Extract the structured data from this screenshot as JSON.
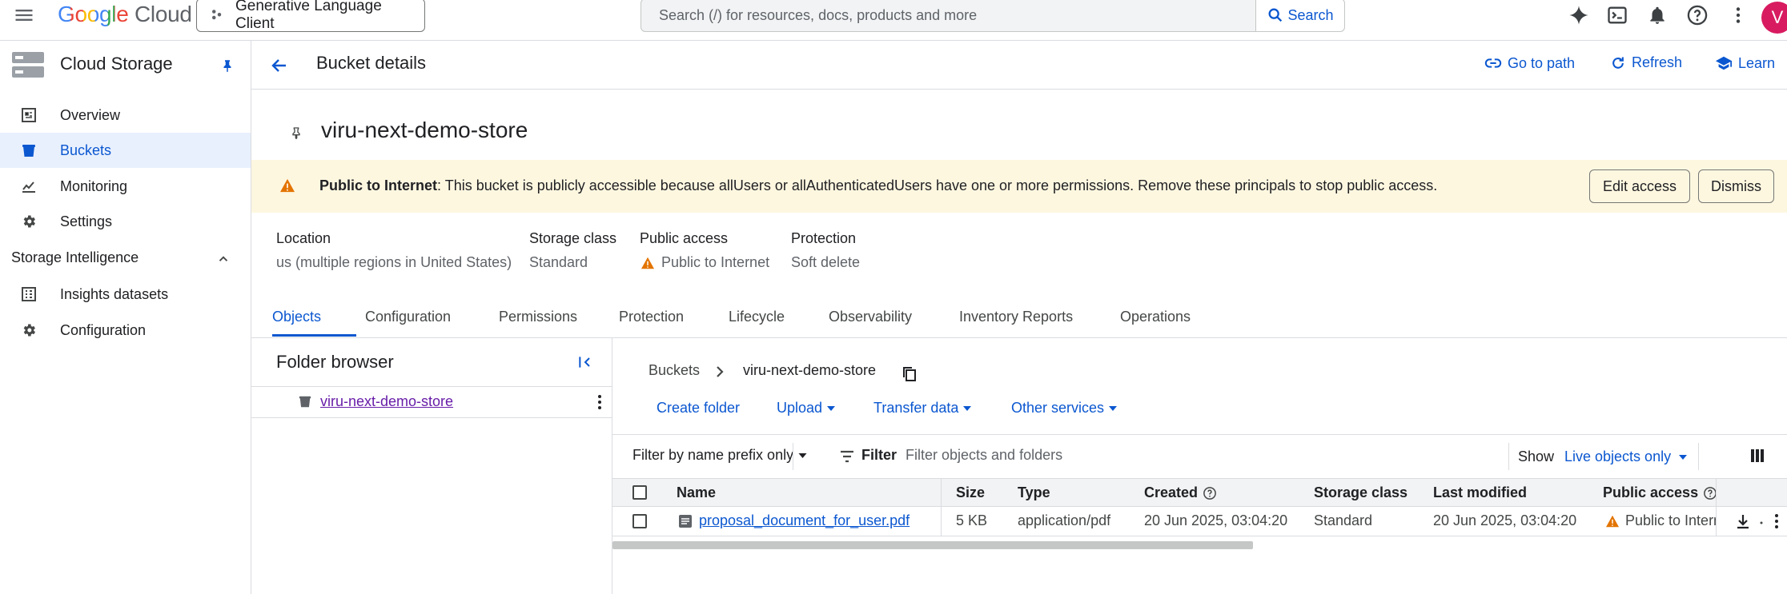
{
  "topbar": {
    "logo_google": "Google",
    "logo_cloud": "Cloud",
    "project": "Generative Language Client",
    "search_placeholder": "Search (/) for resources, docs, products and more",
    "search_button": "Search",
    "avatar_letter": "V"
  },
  "sidebar": {
    "title": "Cloud Storage",
    "items": [
      {
        "label": "Overview",
        "icon": "dashboard-icon"
      },
      {
        "label": "Buckets",
        "icon": "bucket-icon"
      },
      {
        "label": "Monitoring",
        "icon": "monitoring-icon"
      },
      {
        "label": "Settings",
        "icon": "gear-icon"
      }
    ],
    "section": "Storage Intelligence",
    "section_items": [
      {
        "label": "Insights datasets",
        "icon": "dataset-icon"
      },
      {
        "label": "Configuration",
        "icon": "gear-icon"
      }
    ]
  },
  "header": {
    "title": "Bucket details",
    "go_to_path": "Go to path",
    "refresh": "Refresh",
    "learn": "Learn"
  },
  "bucket": {
    "name": "viru-next-demo-store"
  },
  "banner": {
    "bold": "Public to Internet",
    "text": ": This bucket is publicly accessible because allUsers or allAuthenticatedUsers have one or more permissions. Remove these principals to stop public access.",
    "edit_access": "Edit access",
    "dismiss": "Dismiss"
  },
  "info": {
    "location_label": "Location",
    "location_value": "us (multiple regions in United States)",
    "class_label": "Storage class",
    "class_value": "Standard",
    "public_label": "Public access",
    "public_value": "Public to Internet",
    "protection_label": "Protection",
    "protection_value": "Soft delete"
  },
  "tabs": [
    "Objects",
    "Configuration",
    "Permissions",
    "Protection",
    "Lifecycle",
    "Observability",
    "Inventory Reports",
    "Operations"
  ],
  "folder_browser": {
    "title": "Folder browser",
    "bucket": "viru-next-demo-store"
  },
  "content": {
    "breadcrumb_root": "Buckets",
    "breadcrumb_bucket": "viru-next-demo-store",
    "create_folder": "Create folder",
    "upload": "Upload",
    "transfer_data": "Transfer data",
    "other_services": "Other services",
    "filter_mode": "Filter by name prefix only",
    "filter_label": "Filter",
    "filter_placeholder": "Filter objects and folders",
    "show_label": "Show",
    "show_value": "Live objects only"
  },
  "table": {
    "columns": [
      "Name",
      "Size",
      "Type",
      "Created",
      "Storage class",
      "Last modified",
      "Public access"
    ],
    "rows": [
      {
        "name": "proposal_document_for_user.pdf",
        "size": "5 KB",
        "type": "application/pdf",
        "created": "20 Jun 2025, 03:04:20",
        "storage_class": "Standard",
        "last_modified": "20 Jun 2025, 03:04:20",
        "public_access": "Public to Intern"
      }
    ]
  },
  "colors": {
    "accent": "#0b57d0",
    "warning": "#e37400",
    "banner_bg": "#fef7e0",
    "selected_bg": "#e8f0fe"
  }
}
